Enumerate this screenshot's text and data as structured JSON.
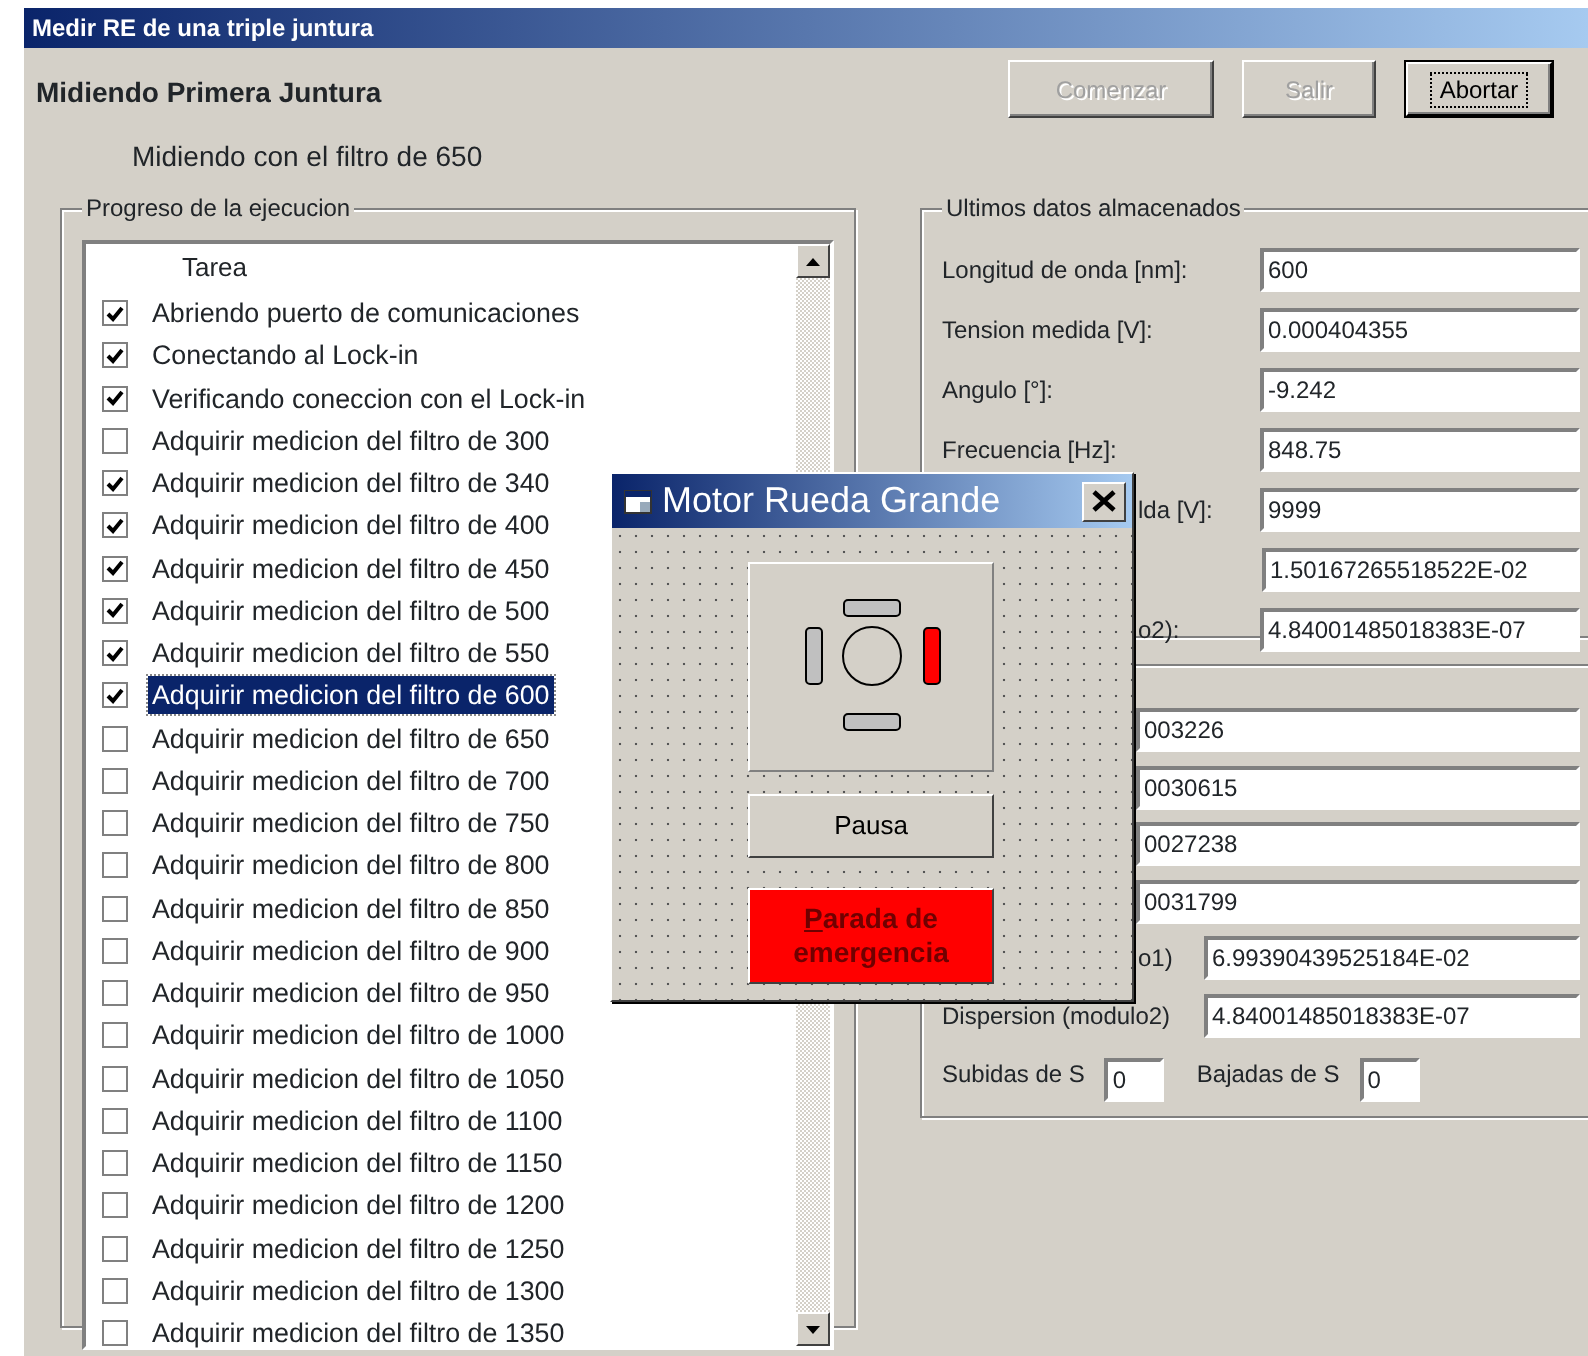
{
  "window": {
    "title": "Medir RE de una triple juntura"
  },
  "heading": "Midiendo Primera Juntura",
  "buttons": [
    {
      "label": "Comenzar",
      "disabled": true,
      "default": false
    },
    {
      "label": "Salir",
      "disabled": true,
      "default": false
    },
    {
      "label": "Abortar",
      "disabled": false,
      "default": true
    }
  ],
  "status": "Midiendo con el filtro de 650",
  "progress": {
    "title": "Progreso de la ejecucion",
    "column": "Tarea",
    "tasks": [
      {
        "label": "Abriendo puerto de comunicaciones",
        "checked": true,
        "selected": false
      },
      {
        "label": "Conectando al Lock-in",
        "checked": true,
        "selected": false
      },
      {
        "label": "Verificando coneccion con el Lock-in",
        "checked": true,
        "selected": false
      },
      {
        "label": "Adquirir medicion del filtro de 300",
        "checked": false,
        "selected": false
      },
      {
        "label": "Adquirir medicion del filtro de 340",
        "checked": true,
        "selected": false
      },
      {
        "label": "Adquirir medicion del filtro de 400",
        "checked": true,
        "selected": false
      },
      {
        "label": "Adquirir medicion del filtro de 450",
        "checked": true,
        "selected": false
      },
      {
        "label": "Adquirir medicion del filtro de 500",
        "checked": true,
        "selected": false
      },
      {
        "label": "Adquirir medicion del filtro de 550",
        "checked": true,
        "selected": false
      },
      {
        "label": "Adquirir medicion del filtro de 600",
        "checked": true,
        "selected": true
      },
      {
        "label": "Adquirir medicion del filtro de 650",
        "checked": false,
        "selected": false
      },
      {
        "label": "Adquirir medicion del filtro de 700",
        "checked": false,
        "selected": false
      },
      {
        "label": "Adquirir medicion del filtro de 750",
        "checked": false,
        "selected": false
      },
      {
        "label": "Adquirir medicion del filtro de 800",
        "checked": false,
        "selected": false
      },
      {
        "label": "Adquirir medicion del filtro de 850",
        "checked": false,
        "selected": false
      },
      {
        "label": "Adquirir medicion del filtro de 900",
        "checked": false,
        "selected": false
      },
      {
        "label": "Adquirir medicion del filtro de 950",
        "checked": false,
        "selected": false
      },
      {
        "label": "Adquirir medicion del filtro de 1000",
        "checked": false,
        "selected": false
      },
      {
        "label": "Adquirir medicion del filtro de 1050",
        "checked": false,
        "selected": false
      },
      {
        "label": "Adquirir medicion del filtro de 1100",
        "checked": false,
        "selected": false
      },
      {
        "label": "Adquirir medicion del filtro de 1150",
        "checked": false,
        "selected": false
      },
      {
        "label": "Adquirir medicion del filtro de 1200",
        "checked": false,
        "selected": false
      },
      {
        "label": "Adquirir medicion del filtro de 1250",
        "checked": false,
        "selected": false
      },
      {
        "label": "Adquirir medicion del filtro de 1300",
        "checked": false,
        "selected": false
      },
      {
        "label": "Adquirir medicion del filtro de 1350",
        "checked": false,
        "selected": false
      }
    ]
  },
  "last_data": {
    "title": "Ultimos datos almacenados",
    "fields": [
      {
        "label": "Longitud de onda [nm]:",
        "value": "600"
      },
      {
        "label": "Tension medida [V]:",
        "value": "0.000404355"
      },
      {
        "label": "Angulo [°]:",
        "value": "-9.242"
      },
      {
        "label": "Frecuencia [Hz]:",
        "value": "848.75"
      },
      {
        "label": "lda [V]:",
        "label_clipped": true,
        "value": "9999"
      },
      {
        "value": "1.50167265518522E-02"
      },
      {
        "label": "o2):",
        "label_clipped": true,
        "value": "4.84001485018383E-07"
      }
    ]
  },
  "second_panel": {
    "fields": [
      {
        "value": "003226"
      },
      {
        "value": "0030615"
      },
      {
        "value": "0027238"
      },
      {
        "value": "0031799"
      },
      {
        "label": "o1)",
        "label_clipped": true,
        "value": "6.99390439525184E-02"
      },
      {
        "label": "Dispersion (modulo2)",
        "value": "4.84001485018383E-07"
      }
    ],
    "counters": [
      {
        "label": "Subidas de S",
        "value": "0"
      },
      {
        "label": "Bajadas de S",
        "value": "0"
      }
    ]
  },
  "motor_dialog": {
    "title": "Motor Rueda Grande",
    "coils": [
      {
        "kind": "top",
        "on": false
      },
      {
        "kind": "left",
        "on": false
      },
      {
        "kind": "right",
        "on": true
      },
      {
        "kind": "bottom",
        "on": false
      }
    ],
    "pause_button": "Pausa",
    "emergency_button": {
      "label": "Parada de emergencia",
      "mnemonic_underlined": true
    }
  }
}
